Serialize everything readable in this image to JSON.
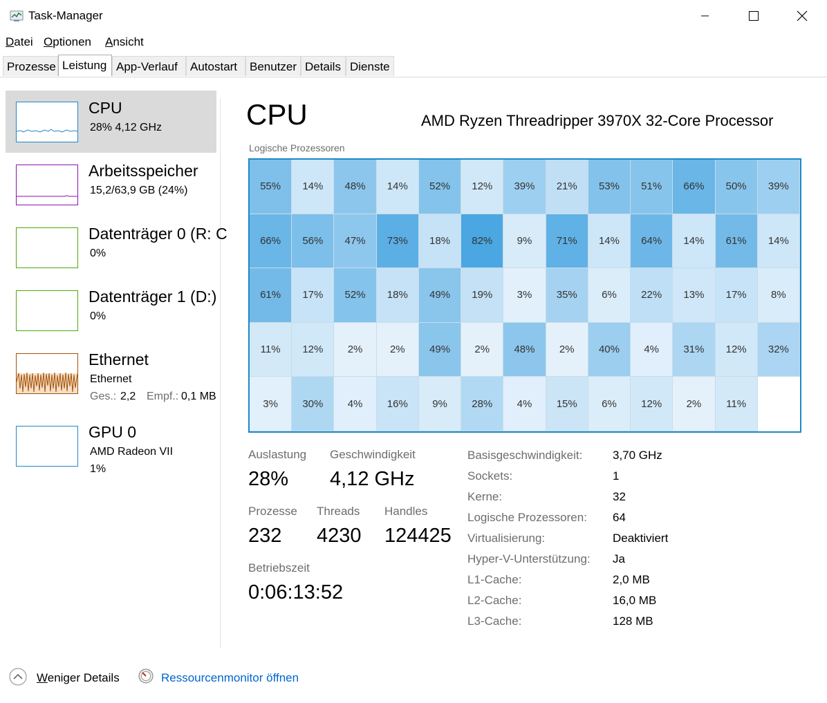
{
  "window": {
    "title": "Task-Manager"
  },
  "menu": [
    {
      "label": "Datei",
      "underline": "D",
      "rest": "atei"
    },
    {
      "label": "Optionen",
      "underline": "O",
      "rest": "ptionen"
    },
    {
      "label": "Ansicht",
      "underline": "A",
      "rest": "nsicht"
    }
  ],
  "tabs": [
    {
      "label": "Prozesse",
      "active": false
    },
    {
      "label": "Leistung",
      "active": true
    },
    {
      "label": "App-Verlauf",
      "active": false
    },
    {
      "label": "Autostart",
      "active": false
    },
    {
      "label": "Benutzer",
      "active": false
    },
    {
      "label": "Details",
      "active": false
    },
    {
      "label": "Dienste",
      "active": false
    }
  ],
  "sidebar": {
    "items": [
      {
        "title": "CPU",
        "sub1": "28%  4,12 GHz",
        "thumb_color": "#1c88c7",
        "selected": true
      },
      {
        "title": "Arbeitsspeicher",
        "sub1": "15,2/63,9 GB (24%)",
        "thumb_color": "#8b12ae",
        "selected": false
      },
      {
        "title": "Datenträger 0 (R: C",
        "sub1": "0%",
        "thumb_color": "#4da60c",
        "selected": false
      },
      {
        "title": "Datenträger 1 (D:)",
        "sub1": "0%",
        "thumb_color": "#4da60c",
        "selected": false
      },
      {
        "title": "Ethernet",
        "sub1": "Ethernet",
        "sub2_label1": "Ges.:",
        "sub2_value1": "2,2",
        "sub2_label2": "Empf.:",
        "sub2_value2": "0,1 MB",
        "thumb_color": "#a74f01",
        "selected": false
      },
      {
        "title": "GPU 0",
        "sub1": "AMD Radeon VII",
        "sub2": "1%",
        "thumb_color": "#1c88c7",
        "selected": false
      }
    ]
  },
  "main": {
    "heading": "CPU",
    "model": "AMD Ryzen Threadripper 3970X 32-Core Processor",
    "grid_label": "Logische Prozessoren",
    "logical_processors": [
      55,
      14,
      48,
      14,
      52,
      12,
      39,
      21,
      53,
      51,
      66,
      50,
      39,
      66,
      56,
      47,
      73,
      18,
      82,
      9,
      71,
      14,
      64,
      14,
      61,
      14,
      61,
      17,
      52,
      18,
      49,
      19,
      3,
      35,
      6,
      22,
      13,
      17,
      8,
      11,
      12,
      2,
      2,
      49,
      2,
      48,
      2,
      40,
      4,
      31,
      12,
      32,
      3,
      30,
      4,
      16,
      9,
      28,
      4,
      15,
      6,
      12,
      2,
      11
    ],
    "stats": [
      {
        "label": "Auslastung",
        "value": "28%"
      },
      {
        "label": "Geschwindigkeit",
        "value": "4,12 GHz"
      },
      {
        "label": "Prozesse",
        "value": "232"
      },
      {
        "label": "Threads",
        "value": "4230"
      },
      {
        "label": "Handles",
        "value": "124425"
      },
      {
        "label": "Betriebszeit",
        "value": "0:06:13:52"
      }
    ],
    "info": [
      {
        "label": "Basisgeschwindigkeit:",
        "value": "3,70 GHz"
      },
      {
        "label": "Sockets:",
        "value": "1"
      },
      {
        "label": "Kerne:",
        "value": "32"
      },
      {
        "label": "Logische Prozessoren:",
        "value": "64"
      },
      {
        "label": "Virtualisierung:",
        "value": "Deaktiviert"
      },
      {
        "label": "Hyper-V-Unterstützung:",
        "value": "Ja"
      },
      {
        "label": "L1-Cache:",
        "value": "2,0 MB"
      },
      {
        "label": "L2-Cache:",
        "value": "16,0 MB"
      },
      {
        "label": "L3-Cache:",
        "value": "128 MB"
      }
    ]
  },
  "footer": {
    "less_details": "Weniger Details",
    "less_details_underline": "W",
    "less_details_rest": "eniger Details",
    "resmon": "Ressourcenmonitor öffnen"
  }
}
